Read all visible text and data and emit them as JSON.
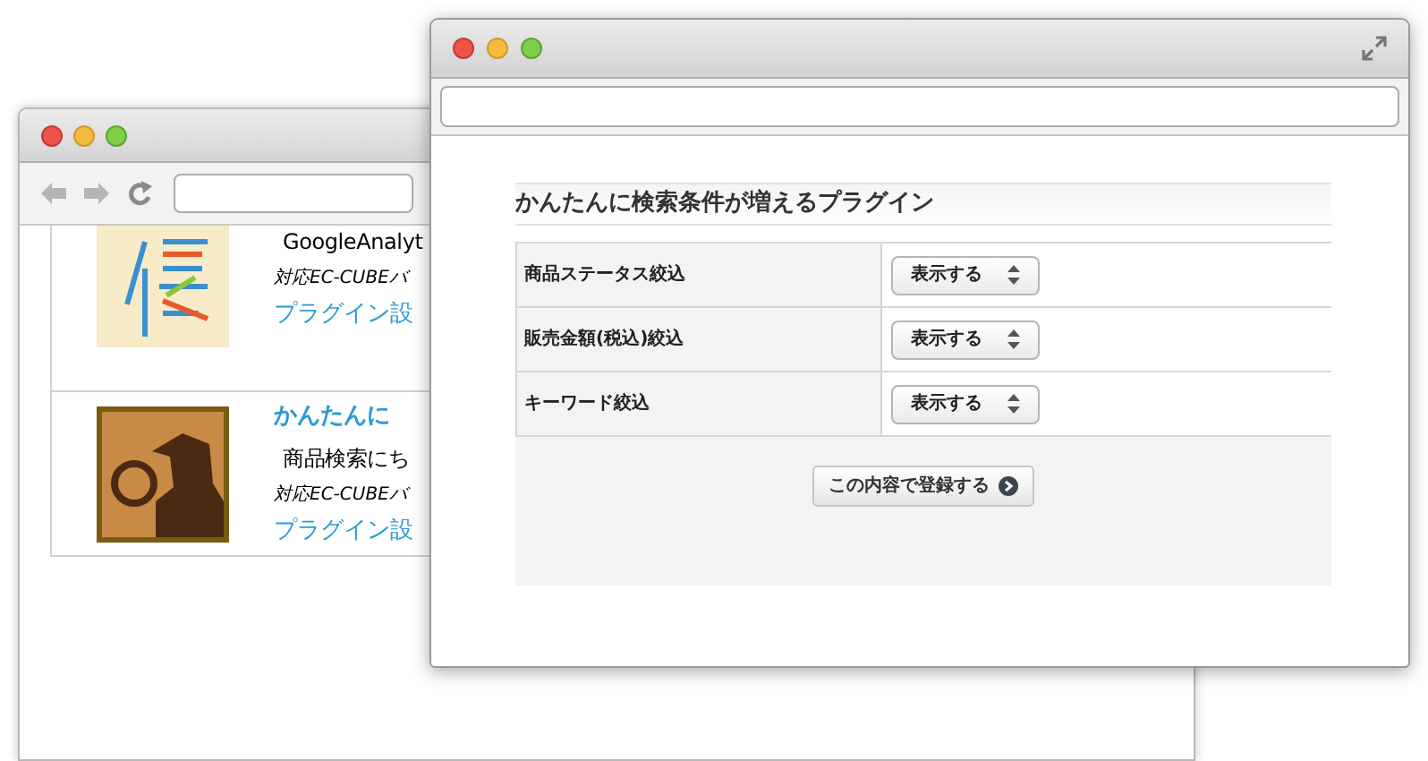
{
  "back_window": {
    "plugins": [
      {
        "description": "GoogleAnalyt",
        "version": "対応EC-CUBEバ",
        "link": "プラグイン設"
      },
      {
        "title": "かんたんに",
        "description": "商品検索にち",
        "version": "対応EC-CUBEバ",
        "link": "プラグイン設"
      }
    ]
  },
  "front_window": {
    "heading": "かんたんに検索条件が増えるプラグイン",
    "settings": [
      {
        "label": "商品ステータス絞込",
        "value": "表示する"
      },
      {
        "label": "販売金額(税込)絞込",
        "value": "表示する"
      },
      {
        "label": "キーワード絞込",
        "value": "表示する"
      }
    ],
    "submit": "この内容で登録する"
  }
}
